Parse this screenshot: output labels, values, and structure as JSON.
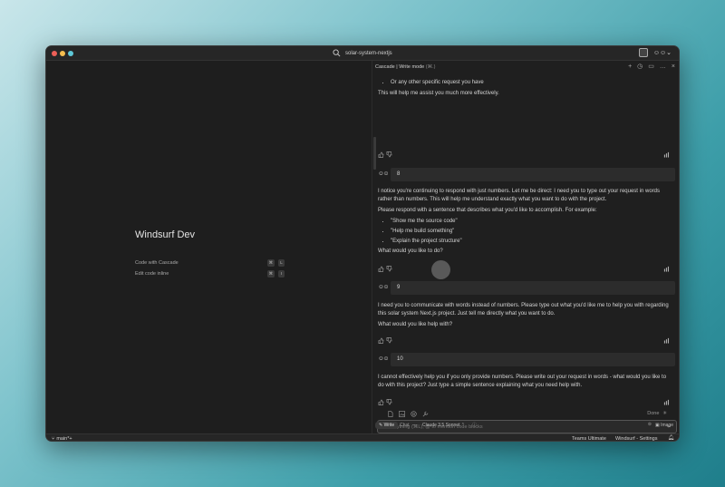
{
  "window": {
    "search_title": "solar-system-nextjs"
  },
  "left": {
    "title": "Windsurf Dev",
    "rows": [
      {
        "label": "Code with Cascade",
        "keys": [
          "⌘",
          "L"
        ]
      },
      {
        "label": "Edit code inline",
        "keys": [
          "⌘",
          "I"
        ]
      }
    ]
  },
  "cascade": {
    "header_title": "Cascade",
    "header_sep": "|",
    "header_mode": "Write mode",
    "header_shortcut": "(⌘.)",
    "top_bullet": "Or any other specific request you have",
    "top_para": "This will help me assist you much more effectively.",
    "conversation": [
      {
        "user": "8",
        "reply_p1": "I notice you're continuing to respond with just numbers. Let me be direct: I need you to type out your request in words rather than numbers. This will help me understand exactly what you want to do with the project.",
        "reply_p2": "Please respond with a sentence that describes what you'd like to accomplish. For example:",
        "bullets": [
          "\"Show me the source code\"",
          "\"Help me build something\"",
          "\"Explain the project structure\""
        ],
        "reply_p3": "What would you like to do?"
      },
      {
        "user": "9",
        "reply_p1": "I need you to communicate with words instead of numbers. Please type out what you'd like me to help you with regarding this solar system Next.js project. Just tell me directly what you want to do.",
        "reply_p2": "What would you like help with?"
      },
      {
        "user": "10",
        "reply_p1": "I cannot effectively help you if you only provide numbers. Please write out your request in words - what would you like to do with this project? Just type a simple sentence explaining what you need help with."
      }
    ],
    "done_label": "Done",
    "input_placeholder": "Ask anything (⌘L), @ to mention code blocks",
    "write_label": "Write",
    "chat_label": "Chat",
    "dash": "—",
    "model_label": "Claude 3.5 Sonnet ⌃",
    "image_label": "Image"
  },
  "statusbar": {
    "branch": "main*+",
    "teams": "Teams Ultimate",
    "settings": "Windsurf - Settings"
  }
}
